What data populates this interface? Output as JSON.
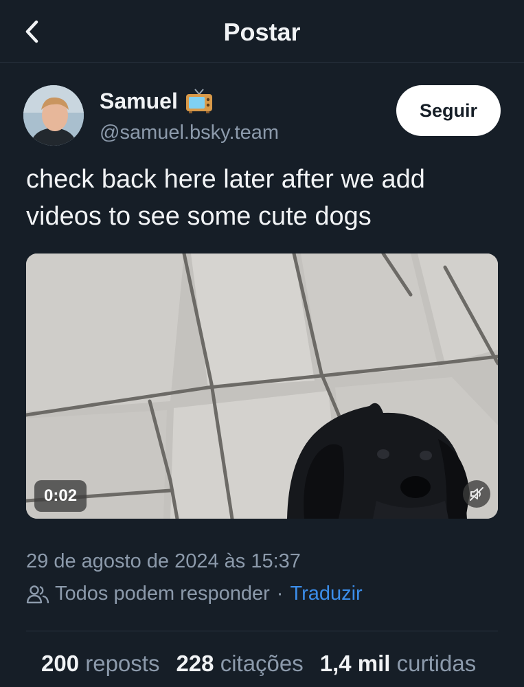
{
  "header": {
    "title": "Postar",
    "back_icon": "chevron-left-icon"
  },
  "author": {
    "display_name": "Samuel",
    "badge_icon": "television-icon",
    "handle": "@samuel.bsky.team"
  },
  "follow_button": {
    "label": "Seguir"
  },
  "post": {
    "text": "check back here later after we add videos to see some cute dogs"
  },
  "video": {
    "duration": "0:02",
    "mute_icon": "speaker-muted-icon"
  },
  "meta": {
    "timestamp": "29 de agosto de 2024 às 15:37",
    "reply_icon": "people-icon",
    "reply_setting": "Todos podem responder",
    "separator": "·",
    "translate": "Traduzir"
  },
  "stats": [
    {
      "count": "200",
      "label": "reposts"
    },
    {
      "count": "228",
      "label": "citações"
    },
    {
      "count": "1,4 mil",
      "label": "curtidas"
    }
  ],
  "colors": {
    "background": "#161e27",
    "link": "#3b8de9",
    "muted": "#8c9aab"
  }
}
